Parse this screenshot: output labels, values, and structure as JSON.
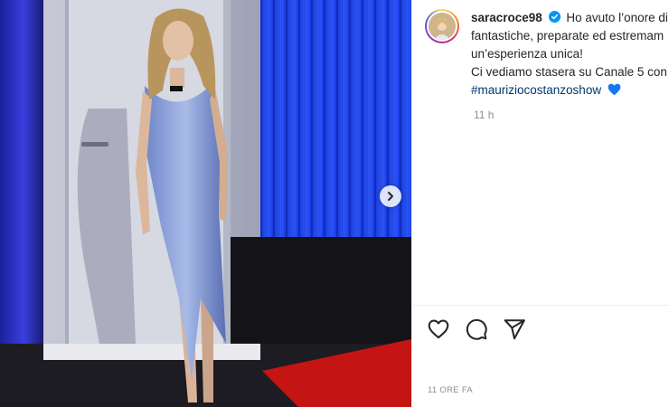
{
  "post": {
    "username": "saracroce98",
    "caption_lines": [
      "Ho avuto l’onore di",
      "fantastiche, preparate ed estremam",
      "un’esperienza unica!",
      "Ci vediamo stasera su Canale 5 con"
    ],
    "hashtag": "#mauriziocostanzoshow",
    "time_ago": "11 h",
    "date_label": "11 ORE FA"
  },
  "icons": {
    "verified": "verified-badge-icon",
    "heart_emoji": "blue-heart-icon",
    "like": "heart-icon",
    "comment": "comment-icon",
    "share": "send-icon",
    "next": "chevron-right-icon"
  },
  "colors": {
    "hashtag": "#00376b",
    "verified": "#0095f6",
    "heart_emoji": "#1877f2",
    "muted": "#8e8e8e"
  }
}
